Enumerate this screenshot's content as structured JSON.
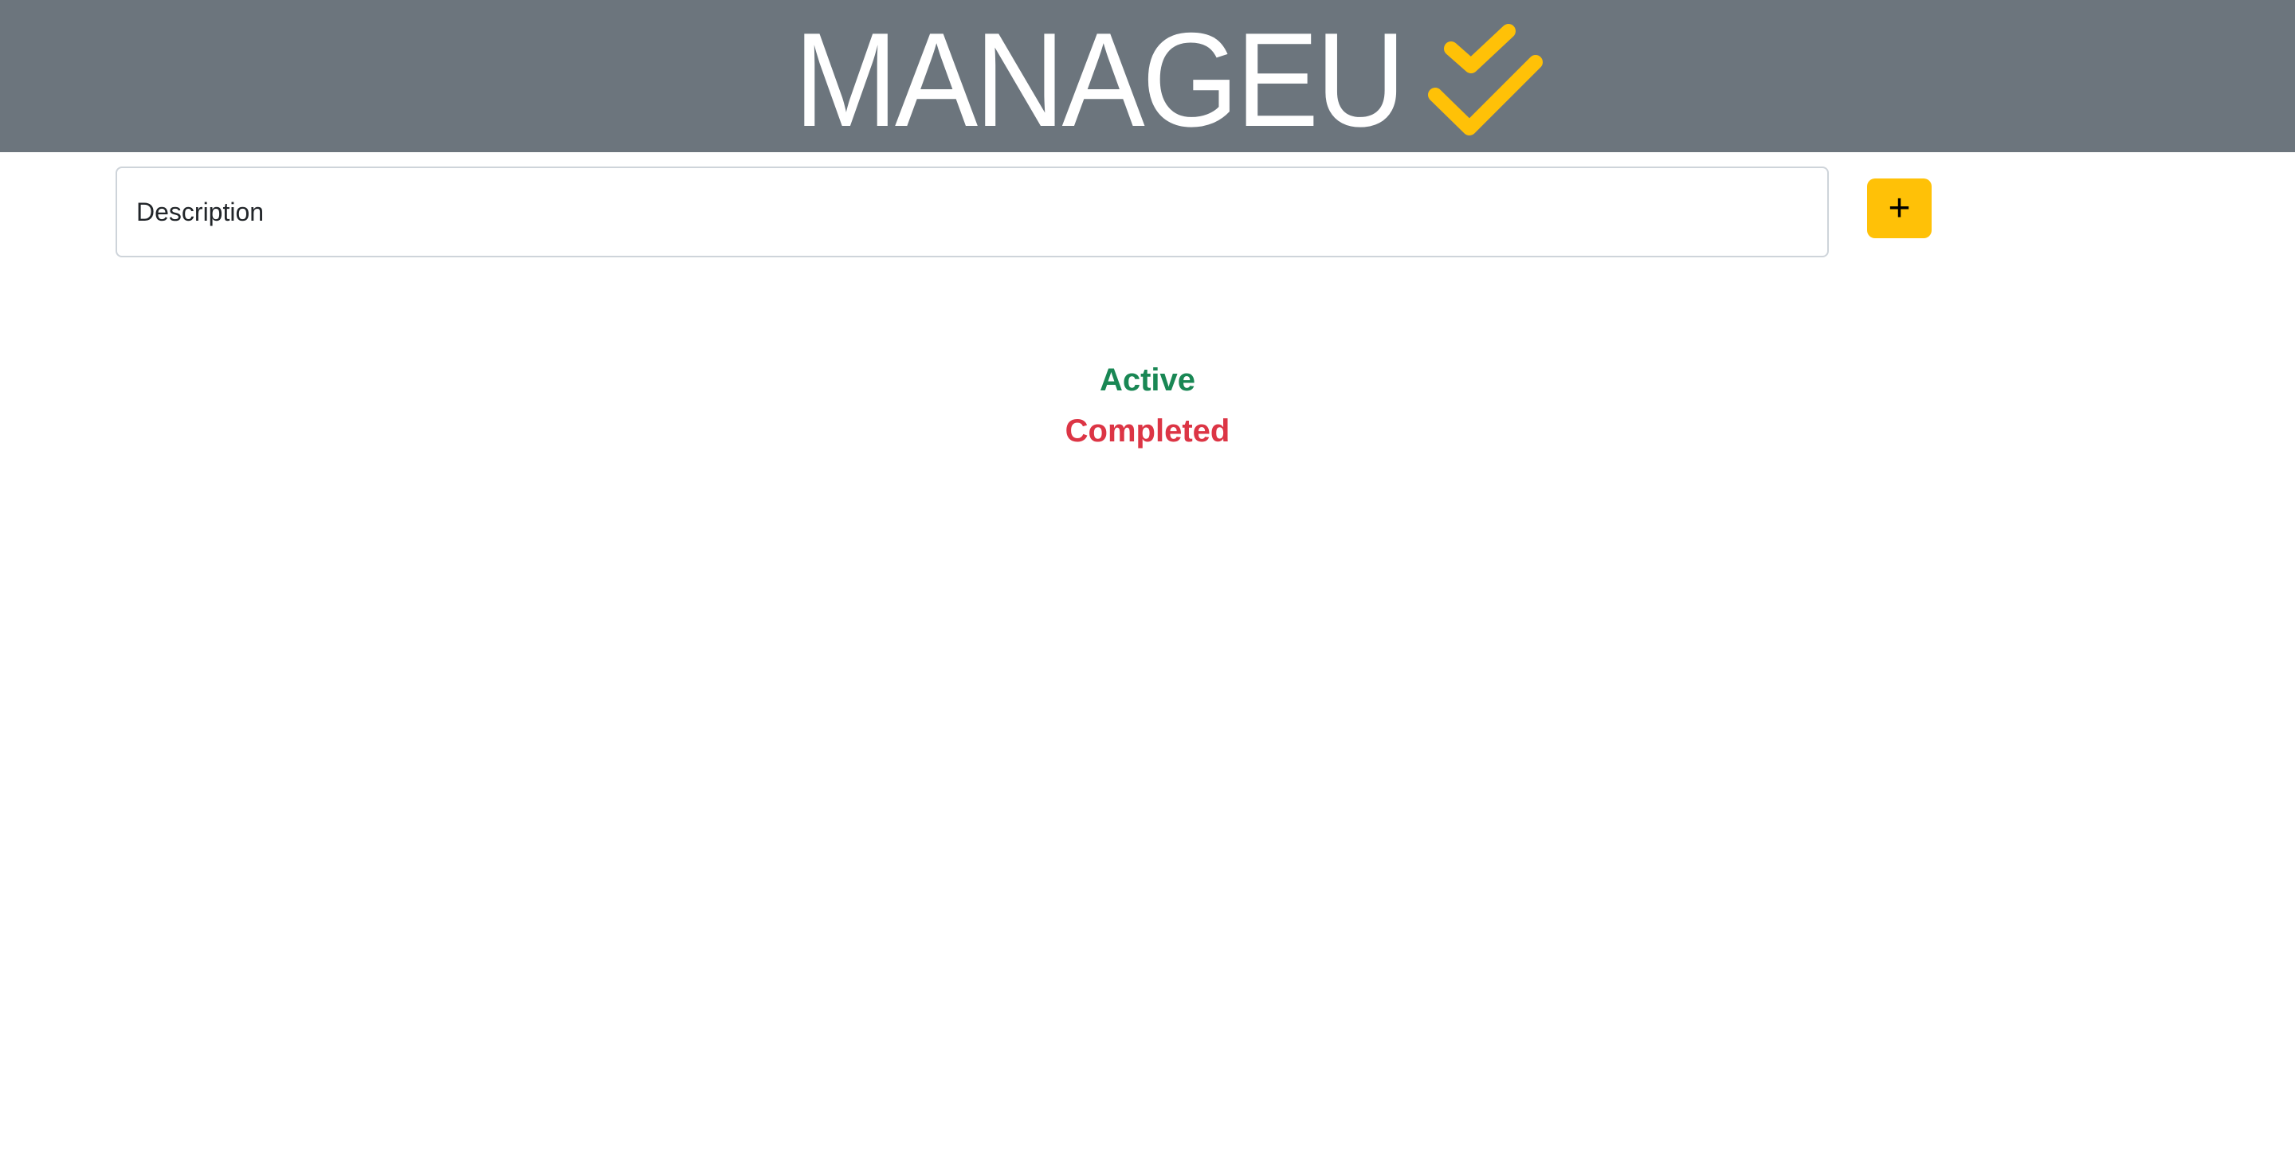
{
  "header": {
    "brand_text": "MANAGEU",
    "brand_icon": "double-check-icon",
    "background_color": "#6c757d",
    "icon_color": "#ffc107"
  },
  "task_form": {
    "description_placeholder": "Description",
    "description_value": "",
    "add_button_label": "+",
    "add_button_color": "#ffc107"
  },
  "filters": {
    "active_label": "Active",
    "active_color": "#198754",
    "completed_label": "Completed",
    "completed_color": "#dc3545"
  }
}
